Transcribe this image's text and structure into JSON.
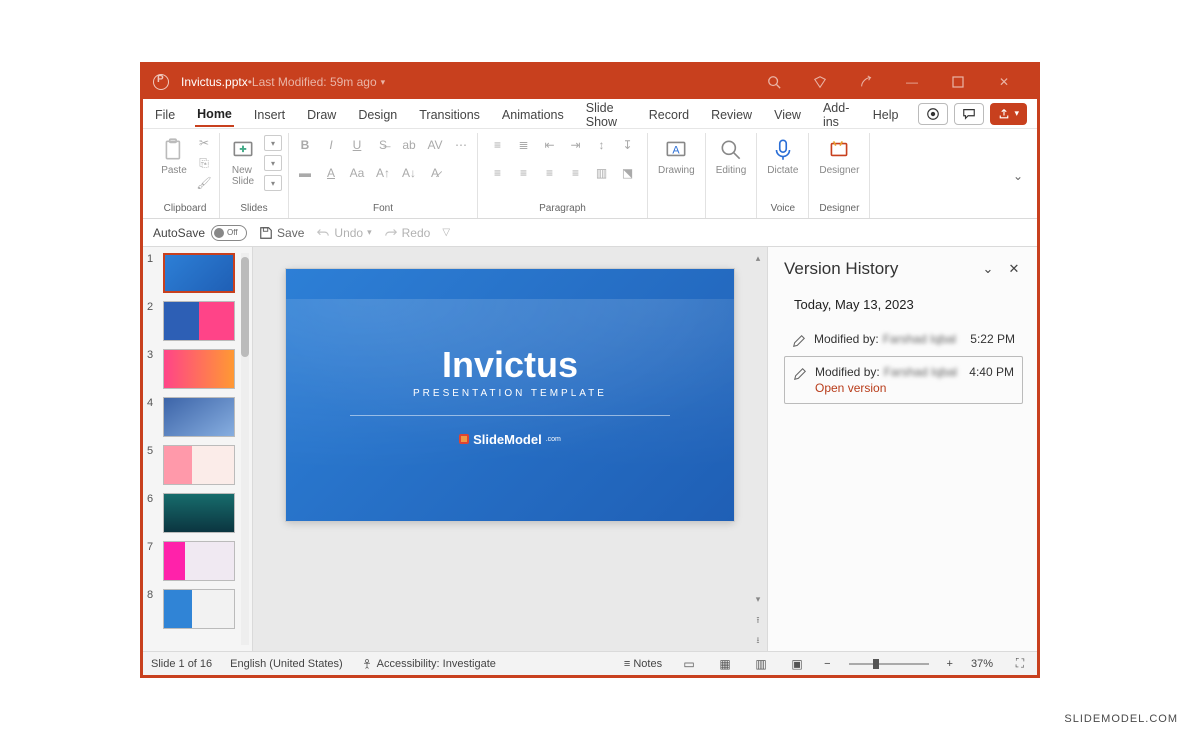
{
  "attribution": "SLIDEMODEL.COM",
  "titlebar": {
    "filename": "Invictus.pptx",
    "separator": " • ",
    "modified": "Last Modified: 59m ago"
  },
  "tabs": {
    "file": "File",
    "home": "Home",
    "insert": "Insert",
    "draw": "Draw",
    "design": "Design",
    "transitions": "Transitions",
    "animations": "Animations",
    "slideshow": "Slide Show",
    "record": "Record",
    "review": "Review",
    "view": "View",
    "addins": "Add-ins",
    "help": "Help"
  },
  "ribbon": {
    "paste": "Paste",
    "clipboard": "Clipboard",
    "newslide": "New\nSlide",
    "slides": "Slides",
    "font": "Font",
    "paragraph": "Paragraph",
    "drawing": "Drawing",
    "editing": "Editing",
    "dictate": "Dictate",
    "voice": "Voice",
    "designer": "Designer",
    "designer_g": "Designer"
  },
  "quick": {
    "autosave": "AutoSave",
    "off": "Off",
    "save": "Save",
    "undo": "Undo",
    "redo": "Redo"
  },
  "slide": {
    "title": "Invictus",
    "subtitle": "PRESENTATION TEMPLATE",
    "logo_text": "SlideModel"
  },
  "thumbs": [
    "1",
    "2",
    "3",
    "4",
    "5",
    "6",
    "7",
    "8"
  ],
  "panel": {
    "title": "Version History",
    "date": "Today, May 13, 2023",
    "modified_by": "Modified by:",
    "open_version": "Open version",
    "versions": [
      {
        "author": "Farshad Iqbal",
        "time": "5:22 PM"
      },
      {
        "author": "Farshad Iqbal",
        "time": "4:40 PM"
      }
    ]
  },
  "status": {
    "slide": "Slide 1 of 16",
    "lang": "English (United States)",
    "access": "Accessibility: Investigate",
    "notes": "Notes",
    "zoom": "37%"
  }
}
